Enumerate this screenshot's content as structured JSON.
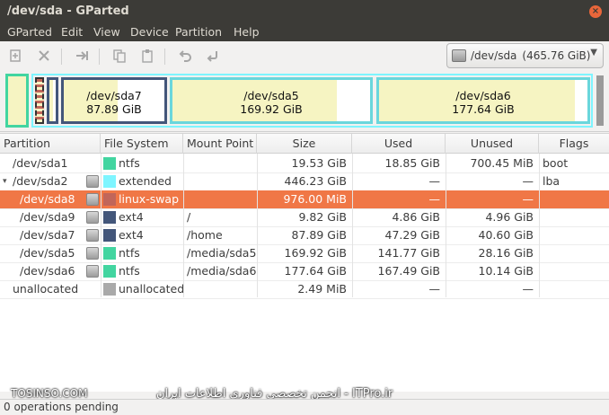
{
  "window": {
    "title": "/dev/sda - GParted",
    "close_glyph": "×"
  },
  "menu": [
    "GParted",
    "Edit",
    "View",
    "Device",
    "Partition",
    "Help"
  ],
  "toolbar": {
    "icons": [
      "new-icon",
      "delete-icon",
      "resize-move-icon",
      "copy-icon",
      "paste-icon",
      "undo-icon",
      "apply-icon"
    ],
    "device_label": "/dev/sda",
    "device_size": "(465.76 GiB)",
    "device_caret": "▼"
  },
  "disk_map": [
    {
      "name": "/dev/sda7",
      "size": "87.89 GiB"
    },
    {
      "name": "/dev/sda5",
      "size": "169.92 GiB"
    },
    {
      "name": "/dev/sda6",
      "size": "177.64 GiB"
    }
  ],
  "table": {
    "columns": [
      "Partition",
      "File System",
      "Mount Point",
      "Size",
      "Used",
      "Unused",
      "Flags"
    ],
    "rows": [
      {
        "partition": "/dev/sda1",
        "fs": "ntfs",
        "fs_color": "#42d5a0",
        "mount": "",
        "size": "19.53 GiB",
        "used": "18.85 GiB",
        "unused": "700.45 MiB",
        "flags": "boot",
        "locked": false,
        "expander": "",
        "selected": false
      },
      {
        "partition": "/dev/sda2",
        "fs": "extended",
        "fs_color": "#7ef5ff",
        "mount": "",
        "size": "446.23 GiB",
        "used": "—",
        "unused": "—",
        "flags": "lba",
        "locked": true,
        "expander": "▾",
        "selected": false
      },
      {
        "partition": "/dev/sda8",
        "fs": "linux-swap",
        "fs_color": "#c1665a",
        "mount": "",
        "size": "976.00 MiB",
        "used": "—",
        "unused": "—",
        "flags": "",
        "locked": true,
        "expander": "",
        "selected": true
      },
      {
        "partition": "/dev/sda9",
        "fs": "ext4",
        "fs_color": "#43567a",
        "mount": "/",
        "size": "9.82 GiB",
        "used": "4.86 GiB",
        "unused": "4.96 GiB",
        "flags": "",
        "locked": true,
        "expander": "",
        "selected": false
      },
      {
        "partition": "/dev/sda7",
        "fs": "ext4",
        "fs_color": "#43567a",
        "mount": "/home",
        "size": "87.89 GiB",
        "used": "47.29 GiB",
        "unused": "40.60 GiB",
        "flags": "",
        "locked": true,
        "expander": "",
        "selected": false
      },
      {
        "partition": "/dev/sda5",
        "fs": "ntfs",
        "fs_color": "#42d5a0",
        "mount": "/media/sda5",
        "size": "169.92 GiB",
        "used": "141.77 GiB",
        "unused": "28.16 GiB",
        "flags": "",
        "locked": true,
        "expander": "",
        "selected": false
      },
      {
        "partition": "/dev/sda6",
        "fs": "ntfs",
        "fs_color": "#42d5a0",
        "mount": "/media/sda6",
        "size": "177.64 GiB",
        "used": "167.49 GiB",
        "unused": "10.14 GiB",
        "flags": "",
        "locked": true,
        "expander": "",
        "selected": false
      },
      {
        "partition": "unallocated",
        "fs": "unallocated",
        "fs_color": "#a9a9a9",
        "mount": "",
        "size": "2.49 MiB",
        "used": "—",
        "unused": "—",
        "flags": "",
        "locked": false,
        "expander": "",
        "selected": false
      }
    ]
  },
  "watermark": {
    "left": "TOSINSO.COM",
    "right": "ITPro.ir - انجمن تخصصی فناوری اطلاعات ایران"
  },
  "status": "0 operations pending"
}
